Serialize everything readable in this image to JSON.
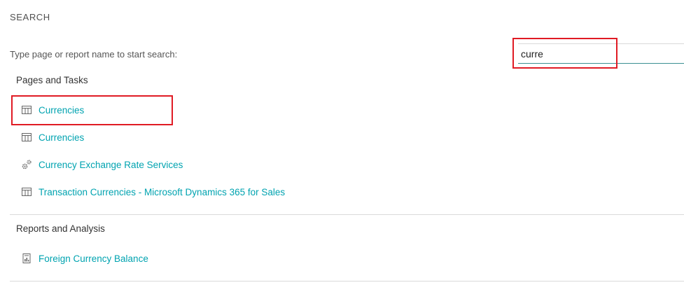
{
  "heading": "SEARCH",
  "search": {
    "prompt": "Type page or report name to start search:",
    "value": "curre"
  },
  "sections": [
    {
      "title": "Pages and Tasks",
      "items": [
        {
          "label": "Currencies",
          "icon": "table-icon"
        },
        {
          "label": "Currencies",
          "icon": "table-icon"
        },
        {
          "label": "Currency Exchange Rate Services",
          "icon": "gears-icon"
        },
        {
          "label": "Transaction Currencies - Microsoft Dynamics 365 for Sales",
          "icon": "table-icon"
        }
      ]
    },
    {
      "title": "Reports and Analysis",
      "items": [
        {
          "label": "Foreign Currency Balance",
          "icon": "report-icon"
        }
      ]
    }
  ],
  "colors": {
    "link": "#00a3b0",
    "highlight": "#e01b24",
    "input_underline": "#3a8f92"
  }
}
